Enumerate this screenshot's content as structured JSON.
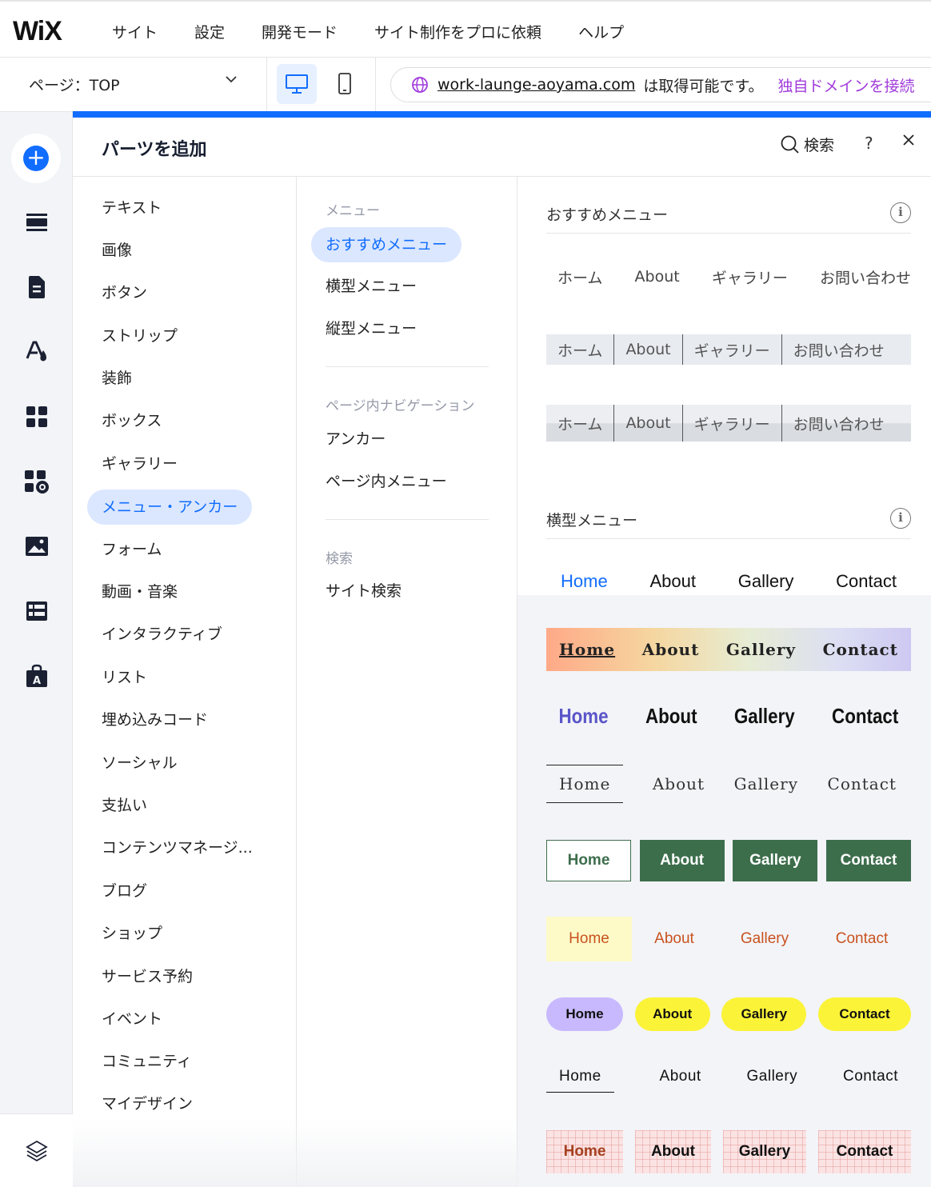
{
  "app": {
    "logo": "WiX"
  },
  "topnav": {
    "items": [
      "サイト",
      "設定",
      "開発モード",
      "サイト制作をプロに依頼",
      "ヘルプ"
    ]
  },
  "subbar": {
    "page_selector": "ページ：TOP",
    "domain": "work-launge-aoyama.com",
    "domain_status": "は取得可能です。",
    "domain_cta": "独自ドメインを接続"
  },
  "panel": {
    "title": "パーツを追加",
    "search_label": "検索",
    "help_label": "?",
    "close_label": "✕"
  },
  "categories": {
    "items": [
      "テキスト",
      "画像",
      "ボタン",
      "ストリップ",
      "装飾",
      "ボックス",
      "ギャラリー",
      "メニュー・アンカー",
      "フォーム",
      "動画・音楽",
      "インタラクティブ",
      "リスト",
      "埋め込みコード",
      "ソーシャル",
      "支払い",
      "コンテンツマネージ...",
      "ブログ",
      "ショップ",
      "サービス予約",
      "イベント",
      "コミュニティ",
      "マイデザイン"
    ],
    "active": "メニュー・アンカー"
  },
  "subcategories": {
    "menu_head": "メニュー",
    "menu_items": [
      "おすすめメニュー",
      "横型メニュー",
      "縦型メニュー"
    ],
    "nav_head": "ページ内ナビゲーション",
    "nav_items": [
      "アンカー",
      "ページ内メニュー"
    ],
    "search_head": "検索",
    "search_items": [
      "サイト検索"
    ]
  },
  "preview": {
    "recommended_title": "おすすめメニュー",
    "horizontal_title": "横型メニュー",
    "jp_items": [
      "ホーム",
      "About",
      "ギャラリー",
      "お問い合わせ"
    ],
    "en_items": [
      "Home",
      "About",
      "Gallery",
      "Contact"
    ]
  },
  "colors": {
    "accent": "#116dff",
    "active_bg": "#dbe7ff",
    "green": "#3d6e4c",
    "yellow": "#fbf337",
    "lavender": "#c8b9ff",
    "domain_cta": "#a13cdb"
  }
}
